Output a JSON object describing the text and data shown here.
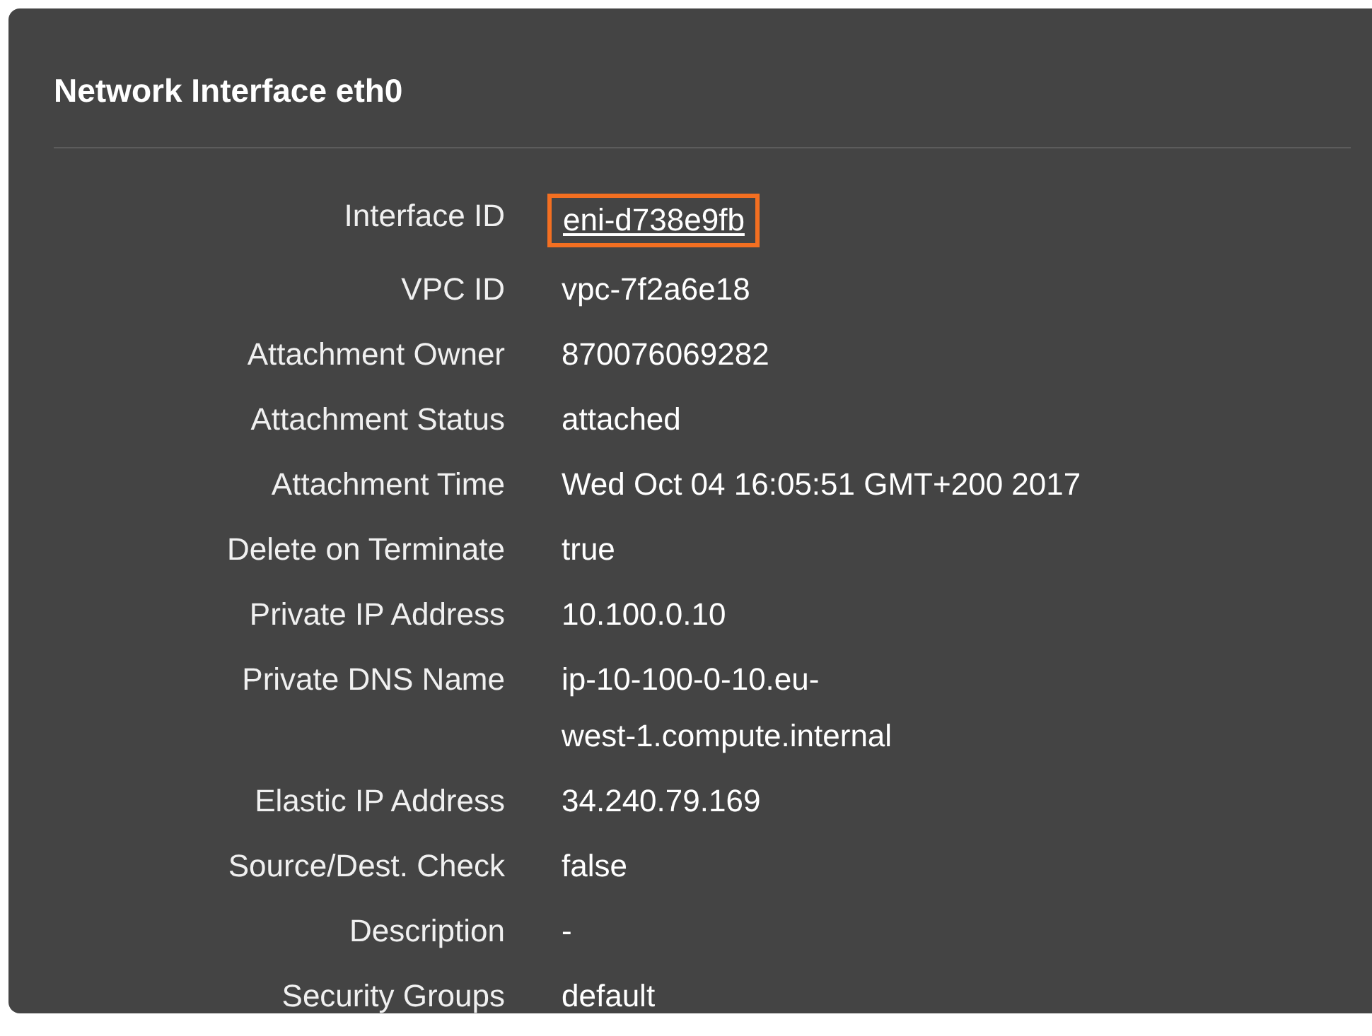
{
  "panel": {
    "title": "Network Interface eth0"
  },
  "rows": [
    {
      "label": "Interface ID",
      "kind": "link",
      "highlighted": true,
      "lines": [
        "eni-d738e9fb"
      ]
    },
    {
      "label": "VPC ID",
      "kind": "text",
      "lines": [
        "vpc-7f2a6e18"
      ]
    },
    {
      "label": "Attachment Owner",
      "kind": "text",
      "lines": [
        "870076069282"
      ]
    },
    {
      "label": "Attachment Status",
      "kind": "text",
      "lines": [
        "attached"
      ]
    },
    {
      "label": "Attachment Time",
      "kind": "text",
      "lines": [
        "Wed Oct 04 16:05:51 GMT+200 2017"
      ]
    },
    {
      "label": "Delete on Terminate",
      "kind": "text",
      "lines": [
        "true"
      ]
    },
    {
      "label": "Private IP Address",
      "kind": "text",
      "lines": [
        "10.100.0.10"
      ]
    },
    {
      "label": "Private DNS Name",
      "kind": "text",
      "lines": [
        "ip-10-100-0-10.eu-",
        "west-1.compute.internal"
      ]
    },
    {
      "label": "Elastic IP Address",
      "kind": "text",
      "lines": [
        "34.240.79.169"
      ]
    },
    {
      "label": "Source/Dest. Check",
      "kind": "text",
      "lines": [
        "false"
      ]
    },
    {
      "label": "Description",
      "kind": "text",
      "lines": [
        "-"
      ]
    },
    {
      "label": "Security Groups",
      "kind": "text",
      "lines": [
        "default"
      ]
    }
  ]
}
